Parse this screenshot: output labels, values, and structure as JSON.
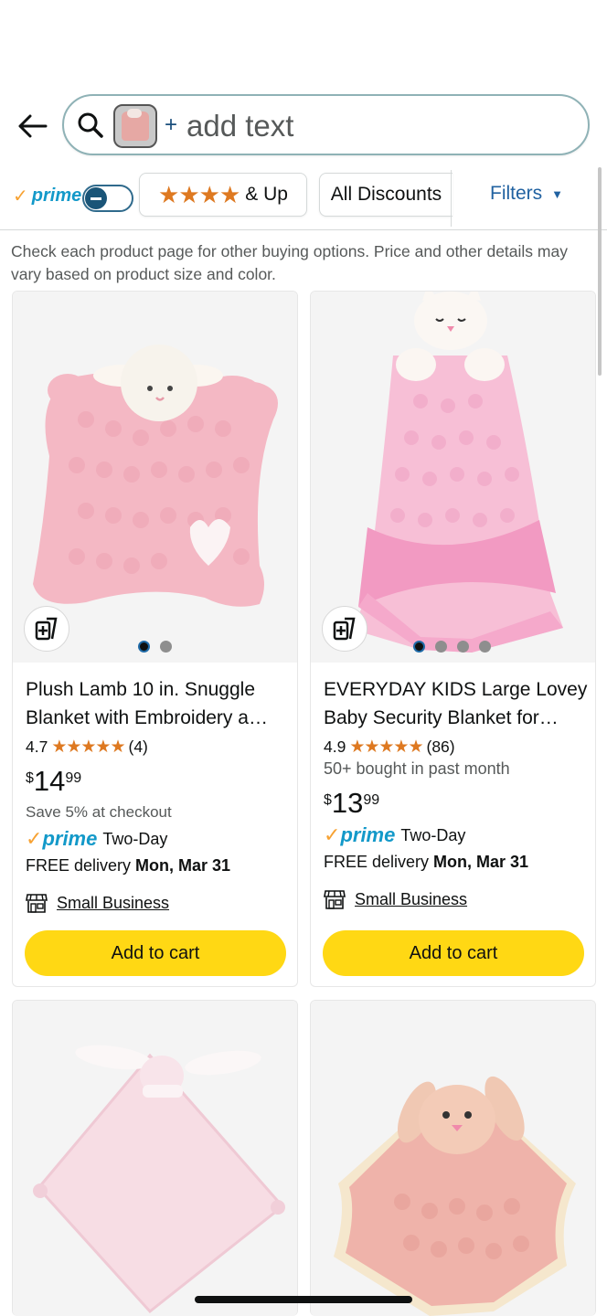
{
  "search": {
    "placeholder": "add text",
    "plus": "+"
  },
  "filters": {
    "prime_label": "prime",
    "prime_check": "✓",
    "stars_chip_stars": "★★★★",
    "stars_chip_label": "& Up",
    "discounts_label": "All Discounts",
    "filters_label": "Filters"
  },
  "notice": "Check each product page for other buying options. Price and other details may vary based on product size and color.",
  "products": [
    {
      "title": "Plush Lamb 10 in. Snuggle Blanket with Embroidery a…",
      "rating": "4.7",
      "stars": "★★★★★",
      "review_count": "(4)",
      "bought": "",
      "price_currency": "$",
      "price_whole": "14",
      "price_fraction": "99",
      "save_text": "Save 5% at checkout",
      "prime_word": "prime",
      "prime_check": "✓",
      "prime_speed": "Two-Day",
      "delivery_prefix": "FREE delivery ",
      "delivery_date": "Mon, Mar 31",
      "badge": "Small Business",
      "add_label": "Add to cart",
      "image_count": 2
    },
    {
      "title": "EVERYDAY KIDS Large Lovey Baby Security Blanket for…",
      "rating": "4.9",
      "stars": "★★★★★",
      "review_count": "(86)",
      "bought": "50+ bought in past month",
      "price_currency": "$",
      "price_whole": "13",
      "price_fraction": "99",
      "save_text": "",
      "prime_word": "prime",
      "prime_check": "✓",
      "prime_speed": "Two-Day",
      "delivery_prefix": "FREE delivery ",
      "delivery_date": "Mon, Mar 31",
      "badge": "Small Business",
      "add_label": "Add to cart",
      "image_count": 4
    }
  ],
  "colors": {
    "accent_orange": "#de7921",
    "prime_blue": "#1399c9",
    "link_blue": "#2162a1",
    "add_to_cart": "#ffd814"
  }
}
